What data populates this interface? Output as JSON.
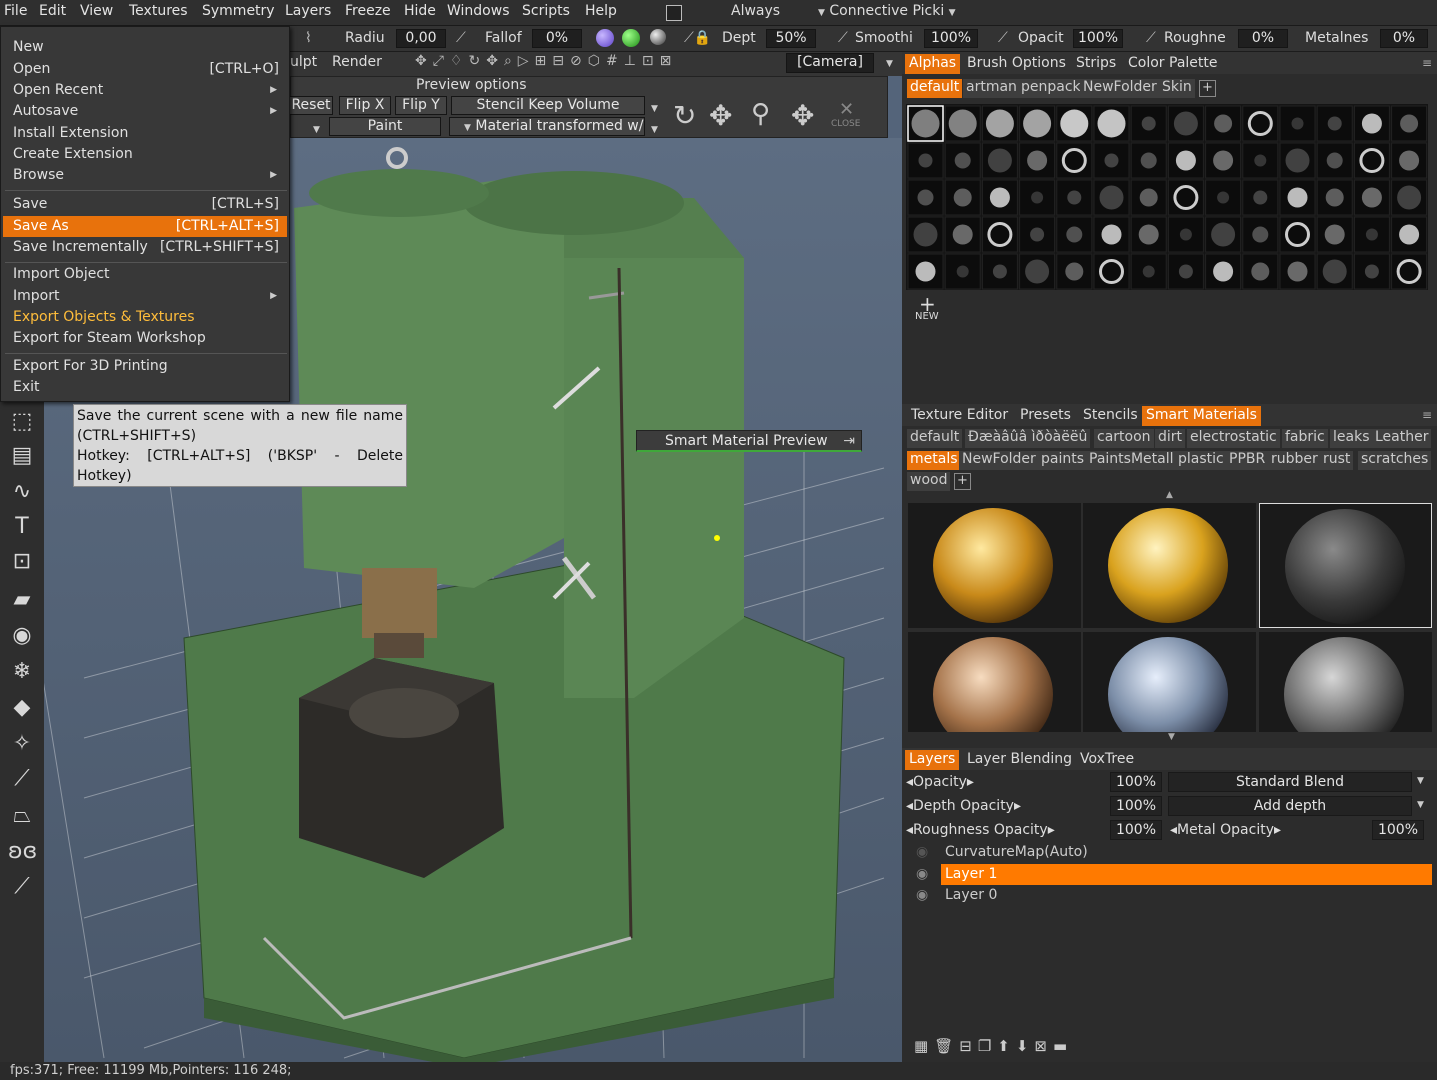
{
  "menubar": {
    "items": [
      "File",
      "Edit",
      "View",
      "Textures",
      "Symmetry",
      "Layers",
      "Freeze",
      "Hide",
      "Windows",
      "Scripts",
      "Help"
    ],
    "always_label": "Always",
    "connective_label": "Connective Picki"
  },
  "toolbar": {
    "radius_label": "Radiu",
    "radius_value": "0,00",
    "falloff_label": "Fallof",
    "falloff_value": "0%",
    "depth_label": "Dept",
    "depth_value": "50%",
    "smooth_label": "Smoothi",
    "smooth_value": "100%",
    "opacity_label": "Opacit",
    "opacity_value": "100%",
    "roughness_label": "Roughne",
    "roughness_value": "0%",
    "metalness_label": "Metalnes",
    "metalness_value": "0%",
    "sculpt_label": "ulpt",
    "render_label": "Render",
    "camera_label": "[Camera]",
    "preview_options": "Preview options",
    "reset_label": "Reset",
    "flipx_label": "Flip X",
    "flipy_label": "Flip Y",
    "stencil_label": "Stencil Keep Volume",
    "paint_label": "Paint",
    "material_label": "Material transformed w/",
    "close_label": "CLOSE"
  },
  "file_menu": {
    "new": "New",
    "open": "Open",
    "open_hk": "[CTRL+O]",
    "open_recent": "Open Recent",
    "autosave": "Autosave",
    "install_ext": "Install Extension",
    "create_ext": "Create Extension",
    "browse": "Browse",
    "save": "Save",
    "save_hk": "[CTRL+S]",
    "save_as": "Save As",
    "save_as_hk": "[CTRL+ALT+S]",
    "save_inc": "Save Incrementally",
    "save_inc_hk": "[CTRL+SHIFT+S]",
    "import_object": "Import Object",
    "import": "Import",
    "export_objects": "Export Objects & Textures",
    "export_steam": "Export for Steam Workshop",
    "export_3d": "Export For 3D Printing",
    "exit": "Exit"
  },
  "tooltip": {
    "line1": "Save the current scene with a new file name (CTRL+SHIFT+S)",
    "line2": "Hotkey: [CTRL+ALT+S]  ('BKSP' - Delete Hotkey)"
  },
  "smart_material_preview": "Smart Material Preview",
  "right_panel": {
    "top_tabs": [
      "Alphas",
      "Brush Options",
      "Strips",
      "Color Palette"
    ],
    "alpha_folders": [
      "default",
      "artman",
      "penpack",
      "NewFolder",
      "Skin"
    ],
    "new_label": "NEW",
    "mid_tabs": [
      "Texture Editor",
      "Presets",
      "Stencils",
      "Smart Materials"
    ],
    "material_folders_row1": [
      "default",
      "Ðæàâûâ ìðòàëëû",
      "cartoon",
      "dirt",
      "electrostatic",
      "fabric",
      "leaks",
      "Leather"
    ],
    "material_folders_row2": [
      "metals",
      "NewFolder",
      "paints",
      "PaintsMetall",
      "plastic",
      "PPBR",
      "rubber",
      "rust",
      "scratches"
    ],
    "material_folders_row3": [
      "wood"
    ],
    "layer_tabs": [
      "Layers",
      "Layer Blending",
      "VoxTree"
    ],
    "opacity_label": "Opacity",
    "opacity_value": "100%",
    "blend_mode": "Standard Blend",
    "depth_opacity_label": "Depth Opacity",
    "depth_opacity_value": "100%",
    "depth_mode": "Add depth",
    "rough_opacity_label": "Roughness Opacity",
    "rough_opacity_value": "100%",
    "metal_opacity_label": "Metal Opacity",
    "metal_opacity_value": "100%",
    "layers": [
      "CurvatureMap(Auto)",
      "Layer 1",
      "Layer 0"
    ]
  },
  "status": "fps:371;   Free: 11199 Mb,Pointers: 116 248;",
  "colors": {
    "accent": "#e8720c",
    "model_green": "#4f7a4a"
  }
}
